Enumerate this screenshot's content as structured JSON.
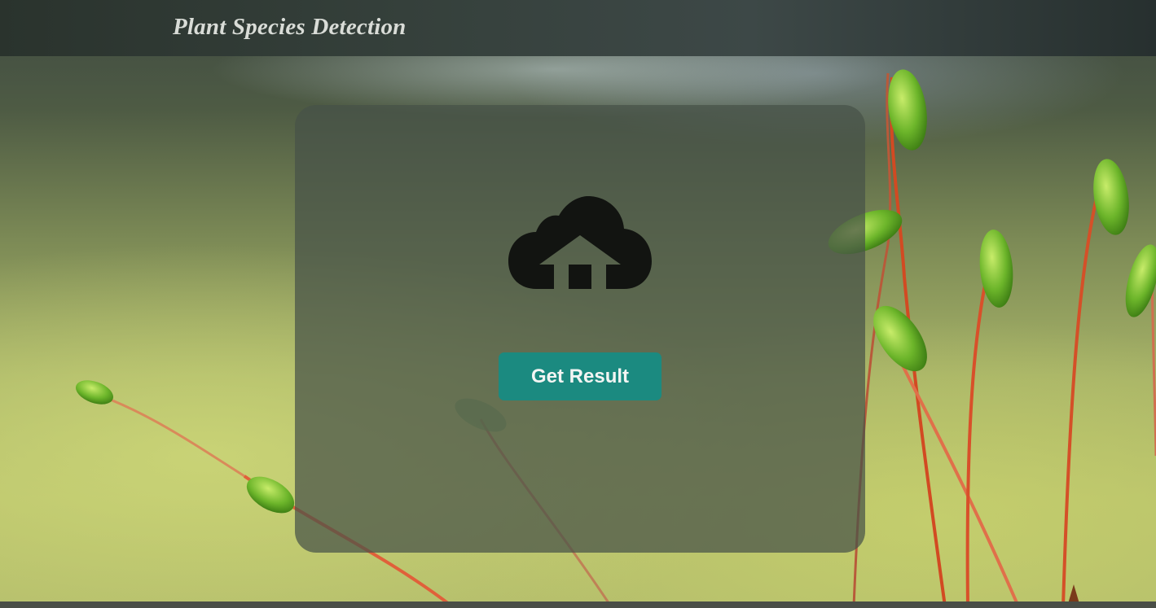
{
  "header": {
    "title": "Plant Species Detection"
  },
  "upload": {
    "icon": "cloud-upload-icon",
    "button_label": "Get Result"
  },
  "colors": {
    "header_bg": "#343e3a",
    "panel_bg": "#4a5649",
    "button_bg": "#1b8a80",
    "button_text": "#f3f5f3",
    "icon": "#121411"
  }
}
